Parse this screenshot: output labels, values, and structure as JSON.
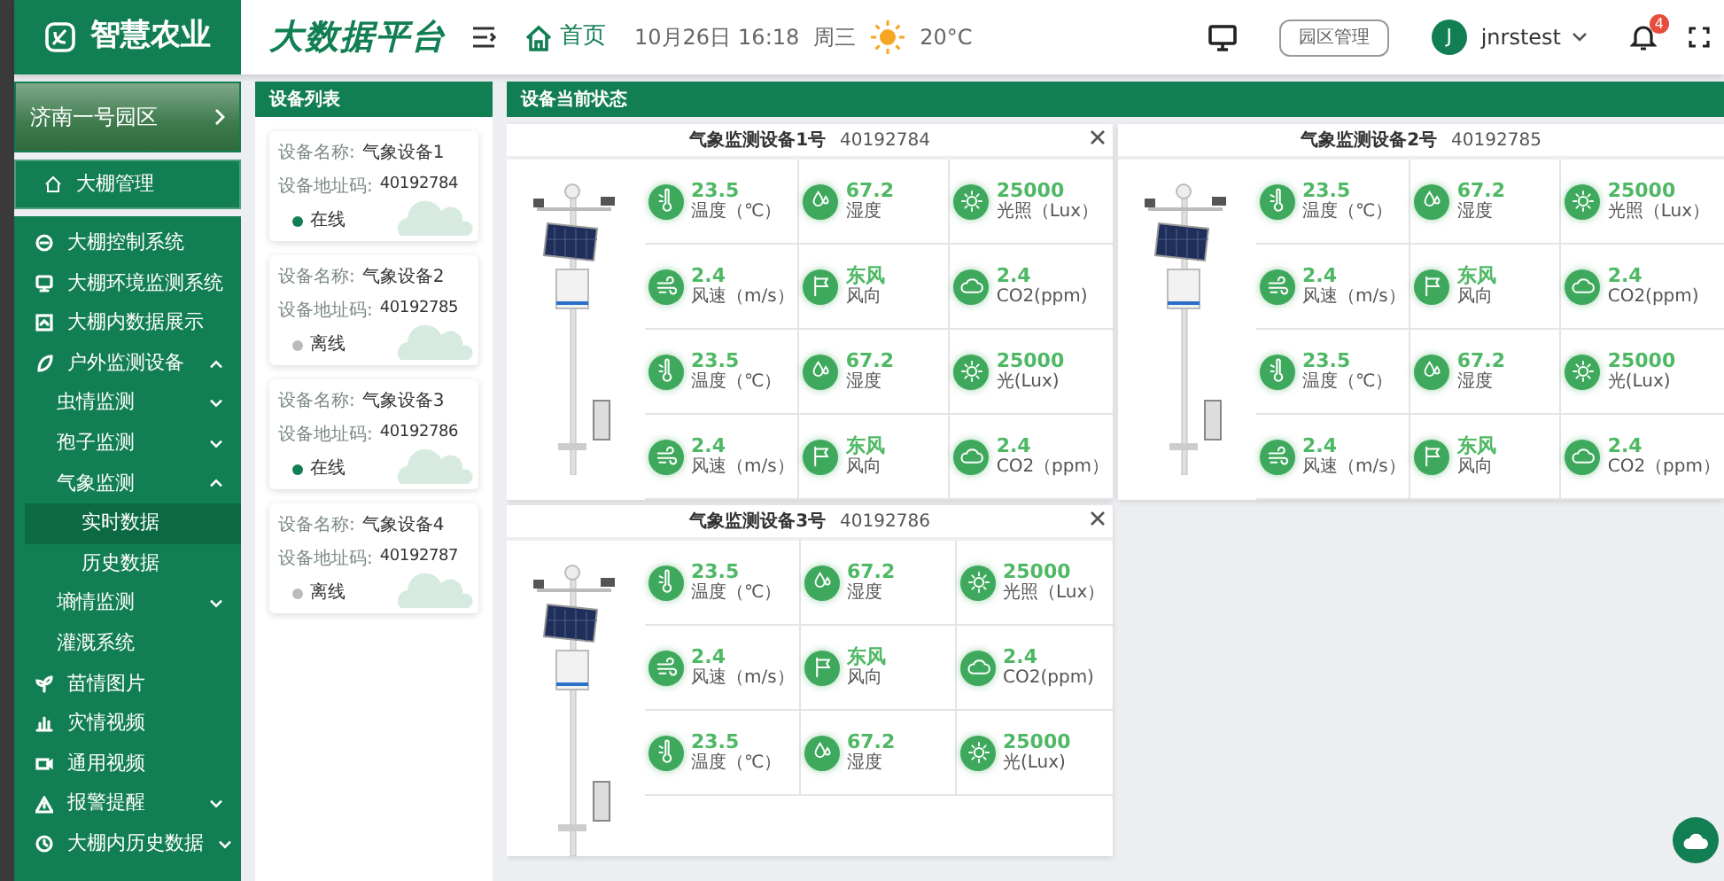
{
  "header": {
    "logo_text": "智慧农业",
    "platform_title": "大数据平台",
    "home_link": "首页",
    "date": "10月26日",
    "time": "16:18",
    "weekday": "周三",
    "temperature": "20°C",
    "park_button": "园区管理",
    "user": {
      "initial": "J",
      "name": "jnrstest"
    },
    "notification_count": "4"
  },
  "sidebar": {
    "park": {
      "name": "济南一号园区"
    },
    "top_item": {
      "label": "大棚管理",
      "selected": false
    },
    "items": [
      {
        "label": "大棚控制系统",
        "selected": false
      },
      {
        "label": "大棚环境监测系统",
        "selected": false
      },
      {
        "label": "大棚内数据展示",
        "selected": false
      },
      {
        "label": "户外监测设备",
        "selected": false,
        "expanded": true,
        "children": [
          {
            "label": "虫情监测",
            "selected": false,
            "expanded": false
          },
          {
            "label": "孢子监测",
            "selected": false,
            "expanded": false
          },
          {
            "label": "气象监测",
            "selected": false,
            "expanded": true,
            "children": [
              {
                "label": "实时数据",
                "selected": true
              },
              {
                "label": "历史数据",
                "selected": false
              }
            ]
          },
          {
            "label": "墒情监测",
            "selected": false,
            "expanded": false
          },
          {
            "label": "灌溉系统",
            "selected": false
          }
        ]
      },
      {
        "label": "苗情图片",
        "selected": false
      },
      {
        "label": "灾情视频",
        "selected": false
      },
      {
        "label": "通用视频",
        "selected": false
      },
      {
        "label": "报警提醒",
        "selected": false,
        "expanded": false
      },
      {
        "label": "大棚内历史数据",
        "selected": false,
        "expanded": false
      }
    ]
  },
  "device_list": {
    "title": "设备列表",
    "devices": [
      {
        "name_label": "设备名称:",
        "name": "气象设备1",
        "code_label": "设备地址码:",
        "code": "40192784",
        "status": "在线",
        "online": true,
        "selected": false
      },
      {
        "name_label": "设备名称:",
        "name": "气象设备2",
        "code_label": "设备地址码:",
        "code": "40192785",
        "status": "离线",
        "online": false,
        "selected": false
      },
      {
        "name_label": "设备名称:",
        "name": "气象设备3",
        "code_label": "设备地址码:",
        "code": "40192786",
        "status": "在线",
        "online": true,
        "selected": false
      },
      {
        "name_label": "设备名称:",
        "name": "气象设备4",
        "code_label": "设备地址码:",
        "code": "40192787",
        "status": "离线",
        "online": false,
        "selected": false
      }
    ]
  },
  "status": {
    "title": "设备当前状态",
    "panels": [
      {
        "name": "气象监测设备1号",
        "code": "40192784",
        "closable": true,
        "rows": [
          [
            {
              "kind": "temperature",
              "value": "23.5",
              "label": "温度（℃）"
            },
            {
              "kind": "humidity",
              "value": "67.2",
              "label": "湿度"
            },
            {
              "kind": "light",
              "value": "25000",
              "label": "光照（Lux）"
            }
          ],
          [
            {
              "kind": "wind",
              "value": "2.4",
              "label": "风速（m/s）"
            },
            {
              "kind": "direction",
              "value": "东风",
              "label": "风向"
            },
            {
              "kind": "co2",
              "value": "2.4",
              "label": "CO2(ppm)"
            }
          ],
          [
            {
              "kind": "temperature",
              "value": "23.5",
              "label": "温度（℃）"
            },
            {
              "kind": "humidity",
              "value": "67.2",
              "label": "湿度"
            },
            {
              "kind": "light",
              "value": "25000",
              "label": "光(Lux)"
            }
          ],
          [
            {
              "kind": "wind",
              "value": "2.4",
              "label": "风速（m/s）"
            },
            {
              "kind": "direction",
              "value": "东风",
              "label": "风向"
            },
            {
              "kind": "co2",
              "value": "2.4",
              "label": "CO2（ppm）"
            }
          ]
        ]
      },
      {
        "name": "气象监测设备2号",
        "code": "40192785",
        "closable": false,
        "rows": [
          [
            {
              "kind": "temperature",
              "value": "23.5",
              "label": "温度（℃）"
            },
            {
              "kind": "humidity",
              "value": "67.2",
              "label": "湿度"
            },
            {
              "kind": "light",
              "value": "25000",
              "label": "光照（Lux）"
            }
          ],
          [
            {
              "kind": "wind",
              "value": "2.4",
              "label": "风速（m/s）"
            },
            {
              "kind": "direction",
              "value": "东风",
              "label": "风向"
            },
            {
              "kind": "co2",
              "value": "2.4",
              "label": "CO2(ppm)"
            }
          ],
          [
            {
              "kind": "temperature",
              "value": "23.5",
              "label": "温度（℃）"
            },
            {
              "kind": "humidity",
              "value": "67.2",
              "label": "湿度"
            },
            {
              "kind": "light",
              "value": "25000",
              "label": "光(Lux)"
            }
          ],
          [
            {
              "kind": "wind",
              "value": "2.4",
              "label": "风速（m/s）"
            },
            {
              "kind": "direction",
              "value": "东风",
              "label": "风向"
            },
            {
              "kind": "co2",
              "value": "2.4",
              "label": "CO2（ppm）"
            }
          ]
        ]
      },
      {
        "name": "气象监测设备3号",
        "code": "40192786",
        "closable": true,
        "rows": [
          [
            {
              "kind": "temperature",
              "value": "23.5",
              "label": "温度（℃）"
            },
            {
              "kind": "humidity",
              "value": "67.2",
              "label": "湿度"
            },
            {
              "kind": "light",
              "value": "25000",
              "label": "光照（Lux）"
            }
          ],
          [
            {
              "kind": "wind",
              "value": "2.4",
              "label": "风速（m/s）"
            },
            {
              "kind": "direction",
              "value": "东风",
              "label": "风向"
            },
            {
              "kind": "co2",
              "value": "2.4",
              "label": "CO2(ppm)"
            }
          ],
          [
            {
              "kind": "temperature",
              "value": "23.5",
              "label": "温度（℃）"
            },
            {
              "kind": "humidity",
              "value": "67.2",
              "label": "湿度"
            },
            {
              "kind": "light",
              "value": "25000",
              "label": "光(Lux)"
            }
          ]
        ]
      }
    ]
  }
}
